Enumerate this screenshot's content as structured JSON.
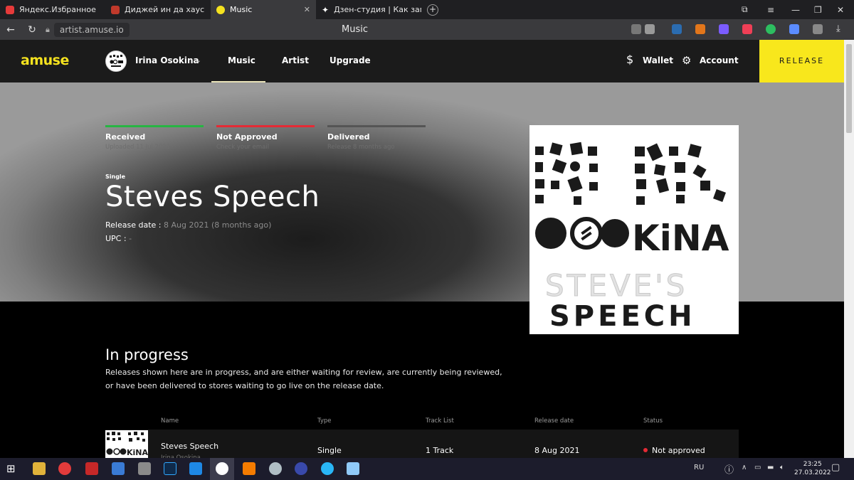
{
  "browser": {
    "tabs": [
      {
        "label": "Яндекс.Избранное",
        "color": "#e63a3a"
      },
      {
        "label": "Диджей ин да хаус",
        "color": "#c0392b"
      },
      {
        "label": "Music",
        "color": "#f5e21f"
      },
      {
        "label": "Дзен-студия | Как загрузи",
        "color": "#ffffff"
      }
    ],
    "url": "artist.amuse.io",
    "page_title": "Music"
  },
  "site": {
    "logo": "amuse",
    "user_name": "Irina Osokina",
    "nav": [
      "Music",
      "Artist",
      "Upgrade"
    ],
    "wallet_label": "Wallet",
    "account_label": "Account",
    "release_button": "RELEASE",
    "accent": "#f8e71c"
  },
  "release": {
    "steps": [
      {
        "label": "Received",
        "sub": "Uploaded 11 Jul 2021",
        "color": "#27b543"
      },
      {
        "label": "Not Approved",
        "sub": "Check your email",
        "color": "#e52a35"
      },
      {
        "label": "Delivered",
        "sub": "Release 8 months ago",
        "color": "#555555"
      }
    ],
    "type": "Single",
    "title": "Steves Speech",
    "release_date_label": "Release date :",
    "release_date_value": "8 Aug 2021",
    "release_date_ago": "(8 months ago)",
    "upc_label": "UPC :",
    "upc_value": "-",
    "cover": {
      "logo_text": "KiNA",
      "title_line1": "STEVE'S",
      "title_line2": "SPEECH"
    }
  },
  "progress": {
    "heading": "In progress",
    "description": "Releases shown here are in progress, and are either waiting for review, are currently being reviewed, or have been delivered to stores waiting to go live on the release date.",
    "columns": [
      "Name",
      "Type",
      "Track List",
      "Release date",
      "Status"
    ],
    "rows": [
      {
        "name": "Steves Speech",
        "artist": "Irina Osokina",
        "type": "Single",
        "tracks": "1 Track",
        "date": "8 Aug 2021",
        "status": "Not approved"
      }
    ]
  },
  "taskbar": {
    "lang": "RU",
    "time": "23:25",
    "date": "27.03.2022"
  }
}
